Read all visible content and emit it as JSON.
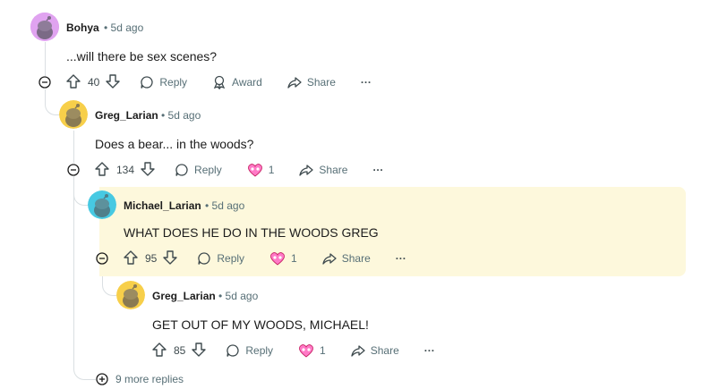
{
  "comments": [
    {
      "author": "Bohya",
      "time": "5d ago",
      "body": "...will there be sex scenes?",
      "score": "40",
      "reply": "Reply",
      "award": "Award",
      "share": "Share",
      "avatar_color": "#e0a3f0"
    },
    {
      "author": "Greg_Larian",
      "time": "5d ago",
      "body": "Does a bear... in the woods?",
      "score": "134",
      "reply": "Reply",
      "award_count": "1",
      "share": "Share",
      "avatar_color": "#f7cf4a"
    },
    {
      "author": "Michael_Larian",
      "time": "5d ago",
      "body": "WHAT DOES HE DO IN THE WOODS GREG",
      "score": "95",
      "reply": "Reply",
      "award_count": "1",
      "share": "Share",
      "avatar_color": "#47c9e2"
    },
    {
      "author": "Greg_Larian",
      "time": "5d ago",
      "body": "GET OUT OF MY WOODS, MICHAEL!",
      "score": "85",
      "reply": "Reply",
      "award_count": "1",
      "share": "Share",
      "avatar_color": "#f7cf4a"
    }
  ],
  "dot": "•",
  "more_replies": "9 more replies",
  "colors": {
    "highlight": "#fdf8dc",
    "meta": "#576f76",
    "thread": "#dadfe2"
  }
}
